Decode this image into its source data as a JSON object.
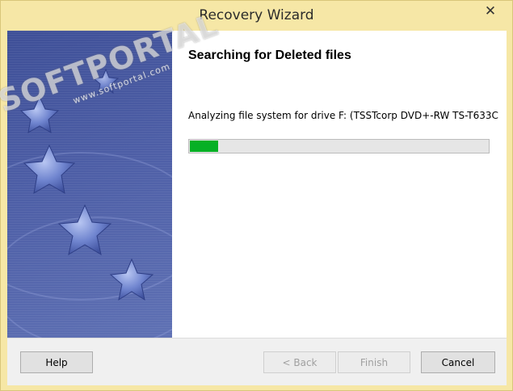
{
  "window": {
    "title": "Recovery Wizard",
    "close_symbol": "✕"
  },
  "main": {
    "heading": "Searching for Deleted files",
    "status": "Analyzing file system for drive F: (TSSTcorp DVD+-RW TS-T633C",
    "progress_fraction": 0.1
  },
  "footer": {
    "help_label": "Help",
    "back_label": "< Back",
    "finish_label": "Finish",
    "cancel_label": "Cancel"
  },
  "watermark": {
    "text": "SOFTPORTAL",
    "url": "www.softportal.com"
  },
  "colors": {
    "titlebar": "#f6e7a6",
    "banner": "#4d5ea6",
    "progress": "#06b025"
  }
}
